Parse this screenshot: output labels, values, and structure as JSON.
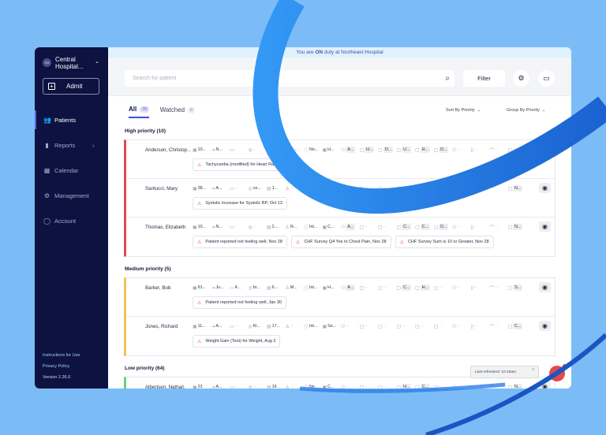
{
  "sidebar": {
    "hospital_initials": "CH",
    "hospital_name": "Central Hospital...",
    "admit_label": "Admit",
    "items": [
      {
        "label": "Patients",
        "icon": "users-icon",
        "active": true
      },
      {
        "label": "Reports",
        "icon": "chart-icon"
      },
      {
        "label": "Calendar",
        "icon": "calendar-icon"
      },
      {
        "label": "Management",
        "icon": "gear-icon"
      },
      {
        "label": "Account",
        "icon": "user-icon"
      }
    ],
    "instructions": "Instructions for Use",
    "privacy": "Privacy Policy",
    "version": "Version 2.26.0"
  },
  "banner": {
    "pre": "You are ",
    "on": "ON",
    "post": " duty at Northeast Hospital"
  },
  "toolbar": {
    "search_placeholder": "Search for patient",
    "filter_label": "Filter"
  },
  "tabs": [
    {
      "label": "All",
      "count": "79"
    },
    {
      "label": "Watched",
      "count": "0"
    }
  ],
  "sort_label": "Sort By Priority",
  "group_label": "Group By Priority",
  "groups": [
    {
      "title": "High priority (10)",
      "color": "#e5484d",
      "rows": [
        {
          "name": "Anderson, Christop...",
          "cells": [
            "10...",
            "N...",
            "--",
            "--",
            "--",
            "O...",
            "No...",
            "H...",
            "A...",
            "H...",
            "O...",
            "U...",
            "H...",
            "D...",
            "--",
            "--",
            "--",
            "--"
          ],
          "alerts": [
            "Tachycardia (modified) for Heart Rate"
          ]
        },
        {
          "name": "Santucci, Mary",
          "cells": [
            "38...",
            "A...",
            "--",
            "ce...",
            "1...",
            "--",
            "--",
            "--",
            "--",
            "--",
            "--",
            "--",
            "--",
            "--",
            "--",
            "--",
            "--",
            "N..."
          ],
          "alerts": [
            "Systolic Increase for Systolic BP, Oct 13"
          ]
        },
        {
          "name": "Thomas, Elizabeth",
          "cells": [
            "10...",
            "N...",
            "--",
            "--",
            "2...",
            "N...",
            "Int...",
            "C...",
            "A...",
            "--",
            "--",
            "C...",
            "C...",
            "D...",
            "--",
            "--",
            "--",
            "N..."
          ],
          "alerts": [
            "Patient reported not feeling well, Nov 28",
            "CHF Survey Q4 Yes to Chest Pain, Nov 28",
            "CHF Survey Sum is 10 or Greater, Nov 28"
          ]
        }
      ]
    },
    {
      "title": "Medium priority (5)",
      "color": "#f0c25a",
      "rows": [
        {
          "name": "Barker, Bob",
          "cells": [
            "91...",
            "Ju...",
            "4...",
            "br...",
            "6...",
            "M...",
            "Int...",
            "H...",
            "A...",
            "--",
            "--",
            "C...",
            "H...",
            "--",
            "--",
            "--",
            "--",
            "S..."
          ],
          "alerts": [
            "Patient reported not feeling well, Jan 30"
          ]
        },
        {
          "name": "Jones, Richard",
          "cells": [
            "11...",
            "A...",
            "--",
            "Kl...",
            "17...",
            "--",
            "Int...",
            "Se...",
            "--",
            "--",
            "--",
            "--",
            "--",
            "--",
            "--",
            "--",
            "--",
            "C..."
          ],
          "alerts": [
            "Weight Gain (Test) for Weight, Aug 2"
          ]
        }
      ]
    },
    {
      "title": "Low priority (64)",
      "color": "#6fcf7a",
      "rows": [
        {
          "name": "Albertsen, Nathan",
          "cells": [
            "23",
            "A...",
            "--",
            "--",
            "16",
            "--",
            "No",
            "C...",
            "--",
            "--",
            "--",
            "H...",
            "C...",
            "--",
            "--",
            "--",
            "--",
            "N..."
          ],
          "alerts": []
        }
      ]
    }
  ],
  "last_refreshed": "Last refreshed: 10:19am",
  "chat_badge": "1"
}
